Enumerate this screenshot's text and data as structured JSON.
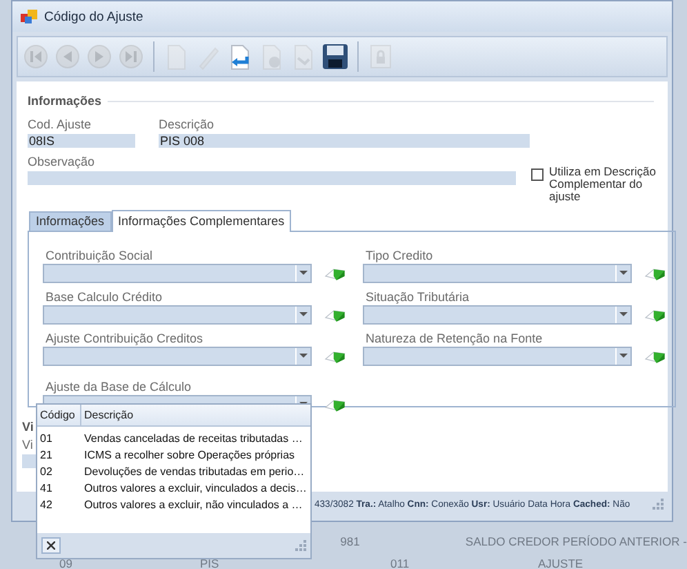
{
  "window": {
    "title": "Código do Ajuste"
  },
  "toolbar": [
    {
      "kind": "first",
      "disabled": true
    },
    {
      "kind": "prev",
      "disabled": true
    },
    {
      "kind": "next",
      "disabled": true
    },
    {
      "kind": "last",
      "disabled": true
    },
    {
      "kind": "new",
      "disabled": true
    },
    {
      "kind": "edit",
      "disabled": true
    },
    {
      "kind": "undo",
      "disabled": false
    },
    {
      "kind": "delete",
      "disabled": true
    },
    {
      "kind": "redo",
      "disabled": true
    },
    {
      "kind": "save",
      "disabled": false
    },
    {
      "kind": "lock",
      "disabled": true
    }
  ],
  "section": {
    "title": "Informações"
  },
  "cod_ajuste": {
    "label": "Cod. Ajuste",
    "value": "08IS"
  },
  "descricao": {
    "label": "Descrição",
    "value": "PIS 008"
  },
  "observacao": {
    "label": "Observação"
  },
  "checkbox": {
    "label": "Utiliza em Descrição Complementar do ajuste",
    "checked": false
  },
  "tabs": [
    {
      "label": "Informações",
      "selected": false
    },
    {
      "label": "Informações Complementares",
      "selected": true
    }
  ],
  "combo_rows": [
    [
      {
        "label": "Contribuição Social"
      },
      {
        "label": "Tipo Credito"
      }
    ],
    [
      {
        "label": "Base Calculo Crédito"
      },
      {
        "label": "Situação Tributária"
      }
    ],
    [
      {
        "label": "Ajuste Contribuição Creditos"
      },
      {
        "label": "Natureza de Retenção na Fonte"
      }
    ],
    [
      {
        "label": "Ajuste da Base de Cálculo"
      }
    ]
  ],
  "section2": {
    "title": "Vi",
    "label": "Vi"
  },
  "dropdown": {
    "columns": [
      "Código",
      "Descrição"
    ],
    "rows": [
      {
        "code": "01",
        "description": "Vendas canceladas de receitas tributadas …"
      },
      {
        "code": "21",
        "description": "ICMS a recolher sobre Operações próprias"
      },
      {
        "code": "02",
        "description": "Devoluções de vendas tributadas em perio…"
      },
      {
        "code": "41",
        "description": "Outros valores a excluir, vinculados a decis…"
      },
      {
        "code": "42",
        "description": "Outros valores a excluir, não vinculados a …"
      }
    ]
  },
  "status_bar": {
    "text": "433/3082 **Tra.:** Atalho **Cnn:** Conexão **Usr:** Usuário Data Hora **Cached:** Não"
  },
  "background_grid": {
    "rows": [
      {
        "column_3": "981",
        "column_4": "SALDO CREDOR PERÍODO ANTERIOR -"
      },
      {
        "column_1": "09",
        "column_2": "PIS",
        "column_3": "011",
        "column_4": "AJUSTE"
      }
    ]
  }
}
